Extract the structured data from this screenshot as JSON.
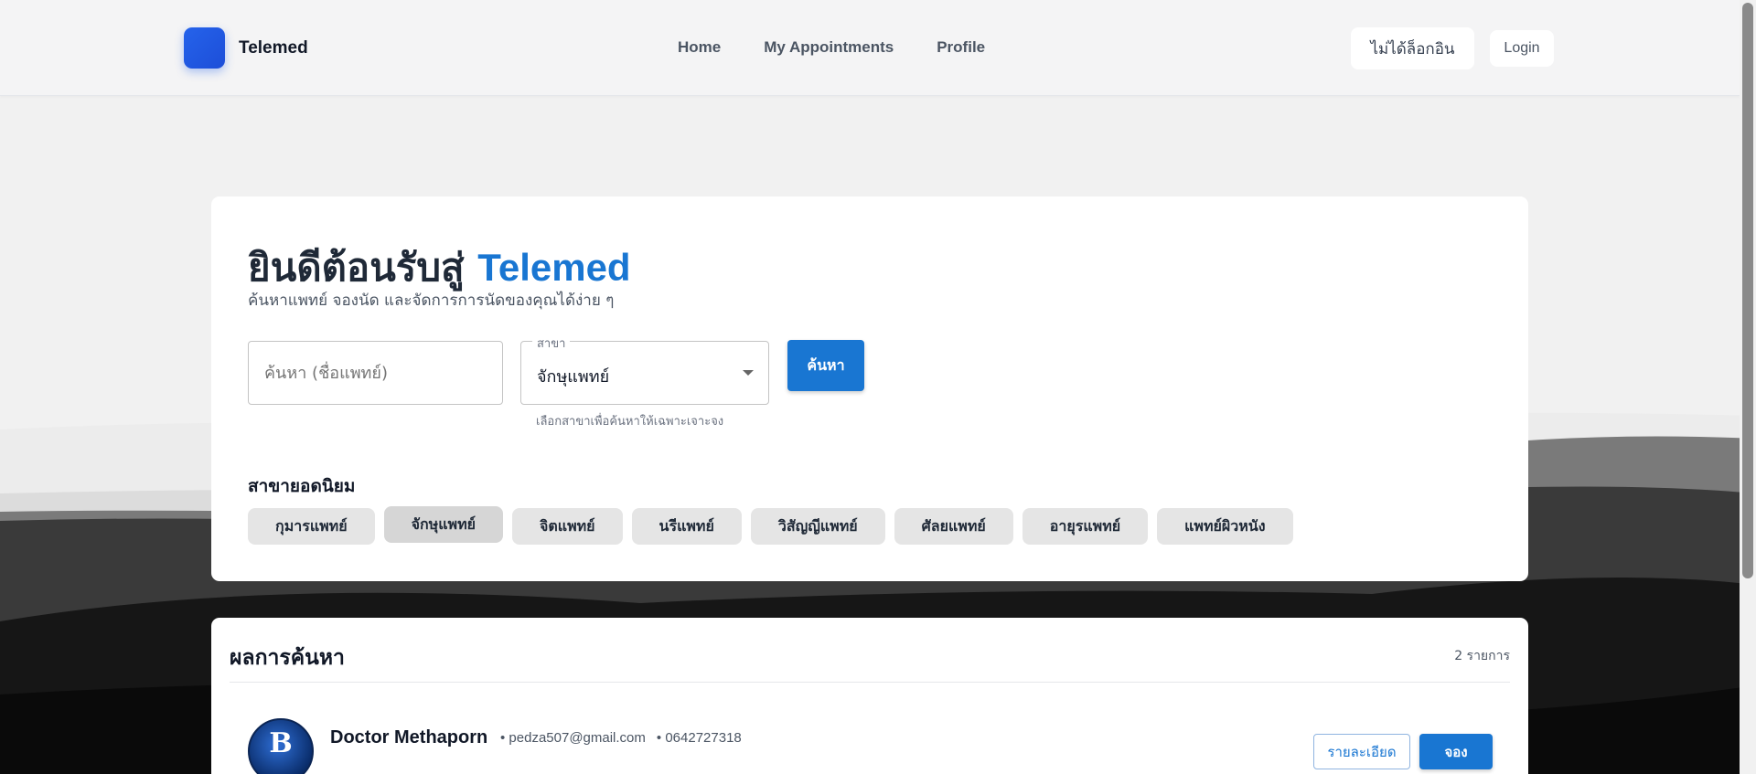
{
  "header": {
    "brand": "Telemed",
    "nav": [
      {
        "label": "Home"
      },
      {
        "label": "My Appointments"
      },
      {
        "label": "Profile"
      }
    ],
    "status_text": "ไม่ได้ล็อกอิน",
    "login_label": "Login"
  },
  "hero": {
    "title_prefix": "ยินดีต้อนรับสู่",
    "title_accent": "Telemed",
    "subtitle": "ค้นหาแพทย์ จองนัด และจัดการการนัดของคุณได้ง่าย ๆ"
  },
  "search": {
    "placeholder": "ค้นหา (ชื่อแพทย์)",
    "select_label": "สาขา",
    "select_value": "จักษุแพทย์",
    "select_helper": "เลือกสาขาเพื่อค้นหาให้เฉพาะเจาะจง",
    "button_label": "ค้นหา"
  },
  "popular": {
    "title": "สาขายอดนิยม",
    "chips": [
      {
        "label": "กุมารแพทย์"
      },
      {
        "label": "จักษุแพทย์"
      },
      {
        "label": "จิตแพทย์"
      },
      {
        "label": "นรีแพทย์"
      },
      {
        "label": "วิสัญญีแพทย์"
      },
      {
        "label": "ศัลยแพทย์"
      },
      {
        "label": "อายุรแพทย์"
      },
      {
        "label": "แพทย์ผิวหนัง"
      }
    ],
    "active_index": 1
  },
  "results": {
    "title": "ผลการค้นหา",
    "count": "2 รายการ",
    "items": [
      {
        "name": "Doctor Methaporn",
        "email": "• pedza507@gmail.com",
        "phone": "• 0642727318",
        "avatar_letter": "B",
        "detail_label": "รายละเอียด",
        "book_label": "จอง"
      }
    ]
  },
  "colors": {
    "accent": "#1976d2",
    "logo": "#2563eb"
  }
}
